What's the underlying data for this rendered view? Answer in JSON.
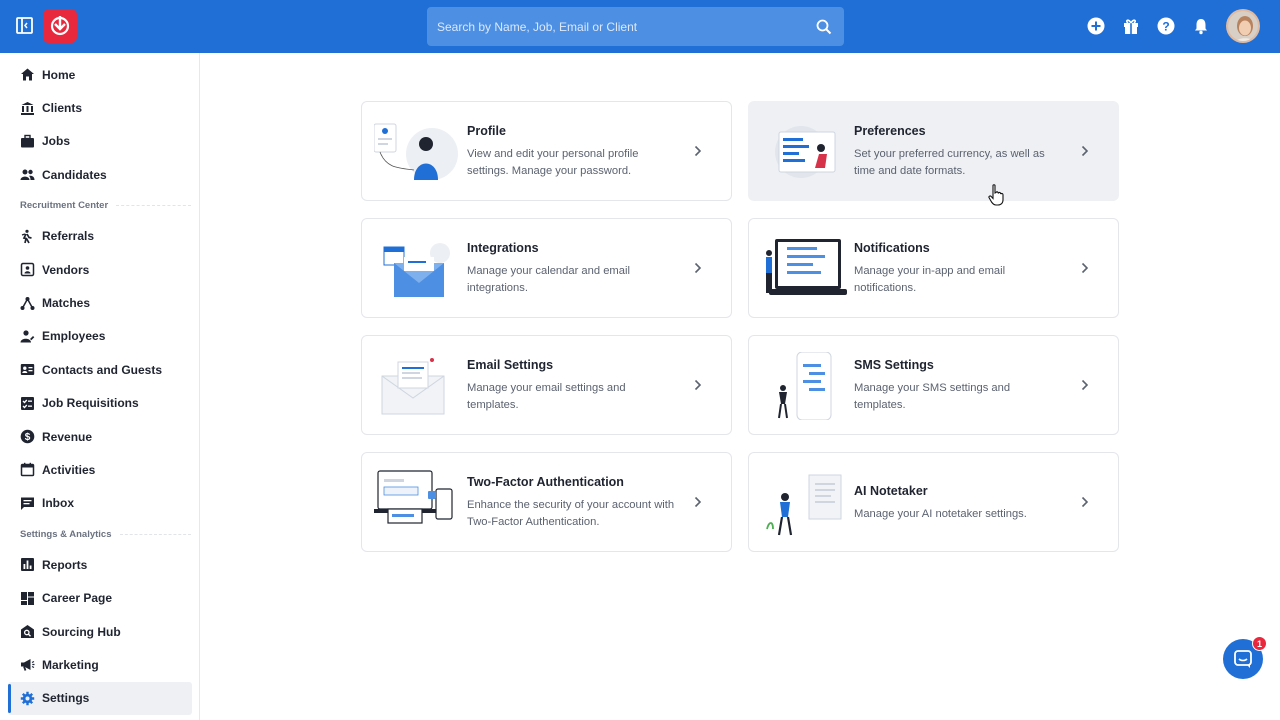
{
  "search": {
    "placeholder": "Search by Name, Job, Email or Client"
  },
  "sidebar": {
    "items": [
      {
        "label": "Home",
        "icon": "home-icon"
      },
      {
        "label": "Clients",
        "icon": "building-icon"
      },
      {
        "label": "Jobs",
        "icon": "briefcase-icon"
      },
      {
        "label": "Candidates",
        "icon": "people-icon"
      }
    ],
    "section1": "Recruitment Center",
    "items2": [
      {
        "label": "Referrals",
        "icon": "referral-icon"
      },
      {
        "label": "Vendors",
        "icon": "vendor-icon"
      },
      {
        "label": "Matches",
        "icon": "matches-icon"
      },
      {
        "label": "Employees",
        "icon": "employee-icon"
      },
      {
        "label": "Contacts and Guests",
        "icon": "contacts-icon"
      },
      {
        "label": "Job Requisitions",
        "icon": "requisition-icon"
      },
      {
        "label": "Revenue",
        "icon": "dollar-icon"
      },
      {
        "label": "Activities",
        "icon": "calendar-icon"
      },
      {
        "label": "Inbox",
        "icon": "inbox-icon"
      }
    ],
    "section2": "Settings & Analytics",
    "items3": [
      {
        "label": "Reports",
        "icon": "reports-icon"
      },
      {
        "label": "Career Page",
        "icon": "career-icon"
      },
      {
        "label": "Sourcing Hub",
        "icon": "sourcing-icon"
      },
      {
        "label": "Marketing",
        "icon": "megaphone-icon"
      },
      {
        "label": "Settings",
        "icon": "gear-icon"
      }
    ]
  },
  "cards": [
    {
      "title": "Profile",
      "desc": "View and edit your personal profile settings. Manage your password."
    },
    {
      "title": "Preferences",
      "desc": "Set your preferred currency, as well as time and date formats."
    },
    {
      "title": "Integrations",
      "desc": "Manage your calendar and email integrations."
    },
    {
      "title": "Notifications",
      "desc": "Manage your in-app and email notifications."
    },
    {
      "title": "Email Settings",
      "desc": "Manage your email settings and templates."
    },
    {
      "title": "SMS Settings",
      "desc": "Manage your SMS settings and templates."
    },
    {
      "title": "Two-Factor Authentication",
      "desc": "Enhance the security of your account with Two-Factor Authentication."
    },
    {
      "title": "AI Notetaker",
      "desc": "Manage your AI notetaker settings."
    }
  ],
  "chat": {
    "badge": "1"
  },
  "colors": {
    "brand": "#1f6fd6",
    "logo": "#e8283c"
  }
}
